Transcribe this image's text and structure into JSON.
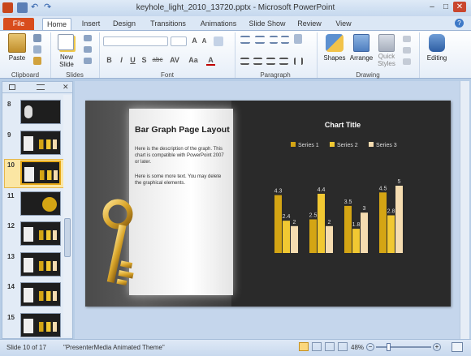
{
  "window": {
    "title": "keyhole_light_2010_13720.pptx - Microsoft PowerPoint"
  },
  "tabs": [
    "File",
    "Home",
    "Insert",
    "Design",
    "Transitions",
    "Animations",
    "Slide Show",
    "Review",
    "View"
  ],
  "ribbon": {
    "paste_label": "Paste",
    "new_slide_label": "New\nSlide",
    "clipboard_label": "Clipboard",
    "slides_label": "Slides",
    "font_label": "Font",
    "paragraph_label": "Paragraph",
    "drawing_label": "Drawing",
    "shapes_label": "Shapes",
    "arrange_label": "Arrange",
    "quick_styles_label": "Quick\nStyles",
    "editing_label": "Editing",
    "font_buttons": [
      "B",
      "I",
      "U",
      "S",
      "abc",
      "AV",
      "Aa",
      "A"
    ]
  },
  "thumbnails": [
    {
      "num": "8",
      "style": "key"
    },
    {
      "num": "9",
      "style": "table"
    },
    {
      "num": "10",
      "style": "chart",
      "selected": true
    },
    {
      "num": "11",
      "style": "pie"
    },
    {
      "num": "12",
      "style": "line"
    },
    {
      "num": "13",
      "style": "bars"
    },
    {
      "num": "14",
      "style": "flow"
    },
    {
      "num": "15",
      "style": "flow"
    }
  ],
  "slide": {
    "heading": "Bar Graph Page Layout",
    "para1": "Here is the description of the graph. This chart is compatible with PowerPoint 2007 or later.",
    "para2": "Here is some more text. You may delete the graphical elements."
  },
  "chart_data": {
    "type": "bar",
    "title": "Chart Title",
    "categories": [
      "1",
      "2",
      "3",
      "4"
    ],
    "series": [
      {
        "name": "Series 1",
        "values": [
          4.3,
          2.5,
          3.5,
          4.5
        ],
        "color": "#d4a514"
      },
      {
        "name": "Series 2",
        "values": [
          2.4,
          4.4,
          1.8,
          2.8
        ],
        "color": "#f1c832"
      },
      {
        "name": "Series 3",
        "values": [
          2,
          2,
          3,
          5
        ],
        "color": "#f5dcb0"
      }
    ],
    "ylim": [
      0,
      5
    ],
    "legend": "top",
    "data_labels": true
  },
  "status": {
    "slide_info": "Slide 10 of 17",
    "theme": "\"PresenterMedia Animated Theme\"",
    "zoom": "48%"
  }
}
